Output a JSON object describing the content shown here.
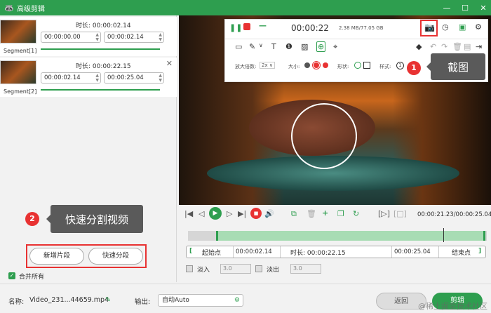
{
  "window": {
    "title": "高级剪辑",
    "logo": "🦝",
    "min": "—",
    "max": "☐",
    "close": "✕"
  },
  "segments": [
    {
      "name": "Segment[1]",
      "duration_label": "时长: 00:00:02.14",
      "start": "00:00:00.00",
      "end": "00:00:02.14",
      "progress": 1.0
    },
    {
      "name": "Segment[2]",
      "duration_label": "时长: 00:00:22.15",
      "start": "00:00:02.14",
      "end": "00:00:25.04",
      "progress": 1.0
    }
  ],
  "buttons": {
    "add_segment": "新增片段",
    "quick_split": "快速分段",
    "merge_all": "合并所有"
  },
  "annotations": {
    "badge1": "1",
    "tip1": "截图",
    "badge2": "2",
    "tip2": "快速分割视频"
  },
  "recorder": {
    "time": "00:00:22",
    "size": "2.38 MB/77.05 GB",
    "zoom_label": "放大倍数:",
    "zoom_value": "2x",
    "size_label": "大小:",
    "shape_label": "形状:",
    "style_label": "样式:",
    "style_value": "1"
  },
  "player": {
    "time_display": "00:00:21.23/00:00:25.04"
  },
  "trim": {
    "start_label": "起始点",
    "start_value": "00:00:02.14",
    "duration_label": "时长: 00:00:22.15",
    "end_value": "00:00:25.04",
    "end_label": "结束点"
  },
  "fade": {
    "fade_in": "淡入",
    "fade_in_value": "3.0",
    "fade_out": "淡出",
    "fade_out_value": "3.0"
  },
  "bottom": {
    "name_label": "名称:",
    "file_name": "Video_231...44659.mp4",
    "output_label": "输出:",
    "output_value": "自动Auto",
    "back": "返回",
    "cut": "剪辑"
  },
  "watermark": "@稀土掘金技术社区",
  "colors": {
    "accent": "#2e9e4f",
    "annotation": "#e83232"
  }
}
